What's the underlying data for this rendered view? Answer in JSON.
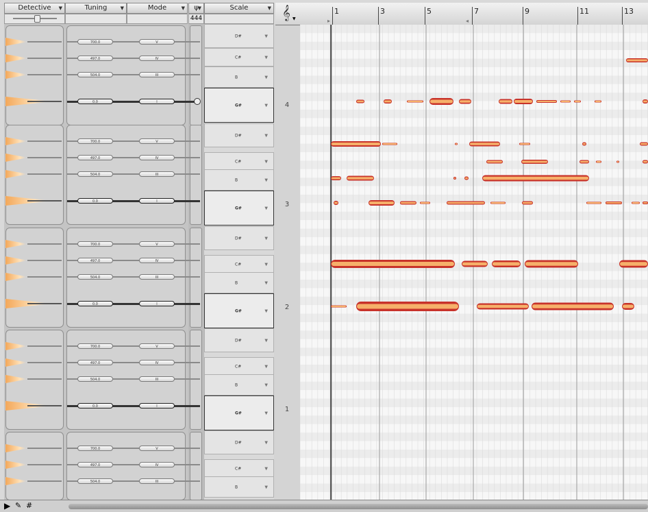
{
  "header": {
    "detective": "Detective",
    "tuning": "Tuning",
    "mode": "Mode",
    "fork_icon": "tuning-fork-icon",
    "scale": "Scale",
    "reference": "444"
  },
  "clef_icon": "treble-clef-icon",
  "ruler": {
    "ticks": [
      "1",
      "3",
      "5",
      "7",
      "9",
      "11",
      "13"
    ]
  },
  "octaves": [
    "4",
    "3",
    "2",
    "1"
  ],
  "group_rows": [
    {
      "tuning": "700.0",
      "mode": "V",
      "note": "D#"
    },
    {
      "tuning": "497.0",
      "mode": "IV",
      "note": "C#"
    },
    {
      "tuning": "504.0",
      "mode": "III",
      "note": "B"
    },
    {
      "tuning": "0.0",
      "mode": "I",
      "note": "G#"
    }
  ],
  "bottom_tools": [
    "pointer-tool-icon",
    "wrench-tool-icon",
    "grid-tool-icon"
  ],
  "colors": {
    "blob_outer": "#c8322a",
    "blob_inner": "#f6b06a",
    "panel": "#c4c4c4",
    "roll": "#fafafa"
  }
}
